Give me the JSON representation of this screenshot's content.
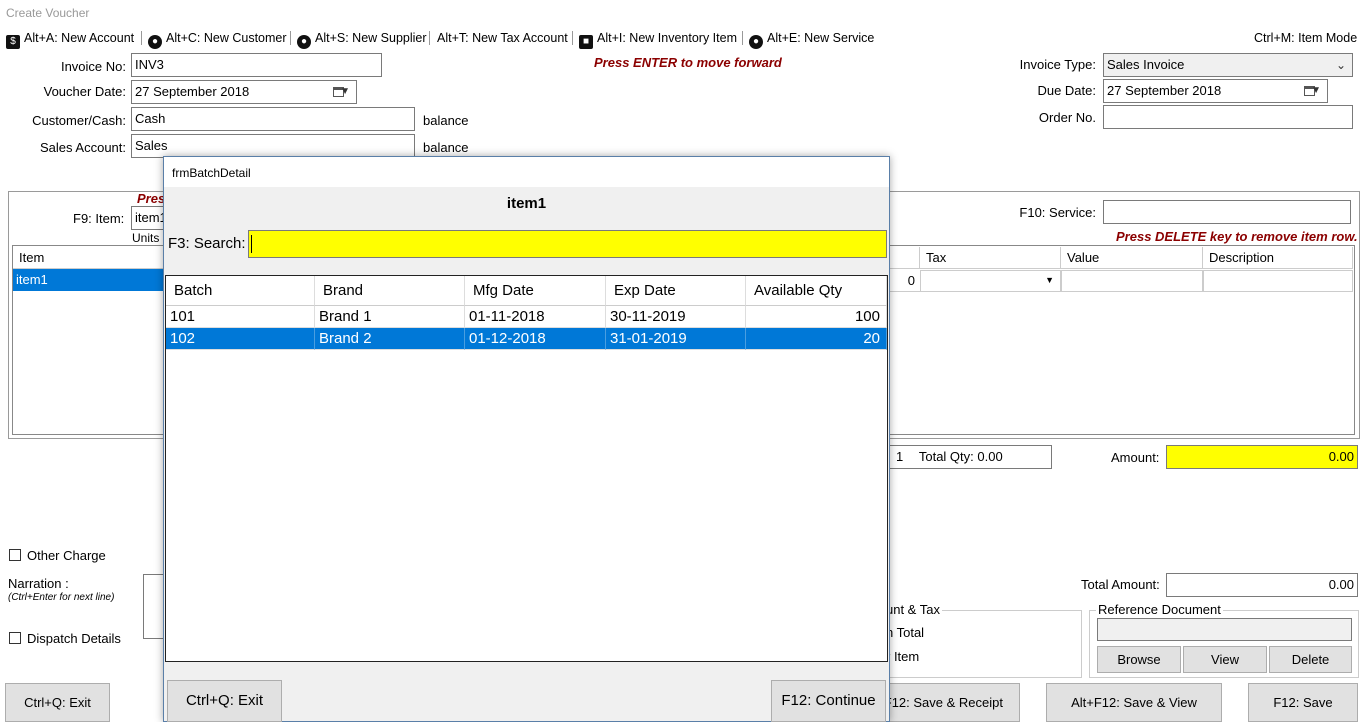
{
  "window": {
    "title": "Create Voucher"
  },
  "shortcuts": [
    {
      "label": "Alt+A: New Account",
      "icon": "dollar-icon"
    },
    {
      "label": "Alt+C: New Customer",
      "icon": "customer-icon"
    },
    {
      "label": "Alt+S: New Supplier",
      "icon": "supplier-icon"
    },
    {
      "label": "Alt+T: New Tax Account",
      "icon": ""
    },
    {
      "label": "Alt+I: New Inventory Item",
      "icon": "truck-icon"
    },
    {
      "label": "Alt+E: New Service",
      "icon": "service-icon"
    }
  ],
  "item_mode_shortcut": "Ctrl+M: Item Mode",
  "form": {
    "invoice_no_label": "Invoice No:",
    "invoice_no": "INV3",
    "voucher_date_label": "Voucher Date:",
    "voucher_date": "27 September 2018",
    "customer_label": "Customer/Cash:",
    "customer": "Cash",
    "customer_balance": "balance",
    "sales_account_label": "Sales Account:",
    "sales_account": "Sales",
    "sales_balance": "balance",
    "enter_hint": "Press ENTER to move forward",
    "invoice_type_label": "Invoice Type:",
    "invoice_type": "Sales Invoice",
    "due_date_label": "Due Date:",
    "due_date": "27 September 2018",
    "order_no_label": "Order No.",
    "order_no": ""
  },
  "items_panel": {
    "press_hint_partial": "Pres",
    "item_label": "F9: Item:",
    "item_value": "item1",
    "units_label": "Units",
    "service_label": "F10: Service:",
    "service_value": "",
    "delete_hint": "Press DELETE key to remove item row.",
    "columns_left": [
      "Item"
    ],
    "columns_right": [
      "Tax",
      "Value",
      "Description"
    ],
    "row": {
      "item": "item1",
      "qty": "0"
    }
  },
  "totals": {
    "count": "1",
    "total_qty": "Total Qty: 0.00",
    "amount_label": "Amount:",
    "amount": "0.00",
    "total_amount_label": "Total Amount:",
    "total_amount": "0.00"
  },
  "bottom": {
    "other_charge": "Other Charge",
    "narration_label": "Narration :",
    "narration_hint": "(Ctrl+Enter for next line)",
    "dispatch_details": "Dispatch Details",
    "discount_partial": "unt & Tax",
    "on_total_partial": "n Total",
    "per_item_partial": "r Item",
    "reference_document": "Reference Document",
    "browse": "Browse",
    "view": "View",
    "delete": "Delete"
  },
  "buttons": {
    "exit": "Ctrl+Q: Exit",
    "save_receipt": "F12: Save & Receipt",
    "save_view": "Alt+F12: Save & View",
    "save": "F12: Save"
  },
  "modal": {
    "title": "frmBatchDetail",
    "item_name": "item1",
    "search_label": "F3: Search:",
    "search_value": "",
    "columns": [
      "Batch",
      "Brand",
      "Mfg Date",
      "Exp Date",
      "Available Qty"
    ],
    "rows": [
      {
        "batch": "101",
        "brand": "Brand 1",
        "mfg": "01-11-2018",
        "exp": "30-11-2019",
        "qty": "100"
      },
      {
        "batch": "102",
        "brand": "Brand 2",
        "mfg": "01-12-2018",
        "exp": "31-01-2019",
        "qty": "20"
      }
    ],
    "exit_button": "Ctrl+Q: Exit",
    "continue_button": "F12: Continue"
  },
  "colors": {
    "selection": "#0078d7",
    "highlight": "#ffff00",
    "hint": "#8b0000"
  }
}
